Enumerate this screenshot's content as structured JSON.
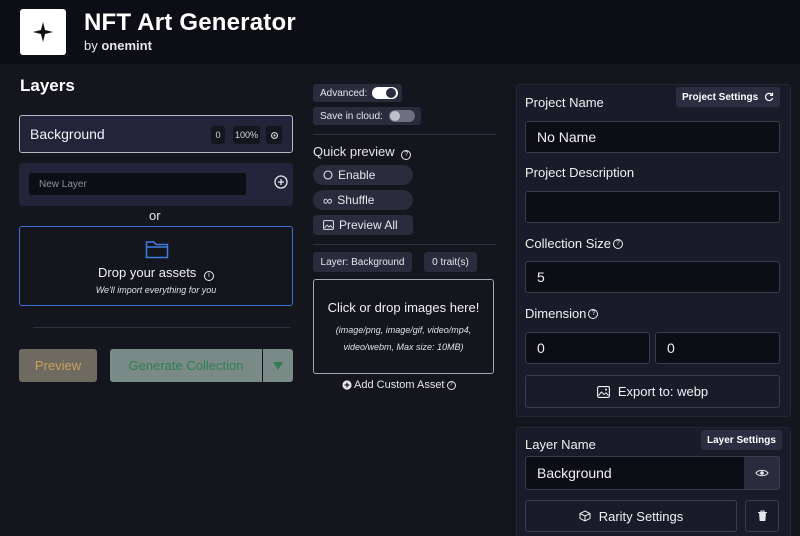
{
  "header": {
    "title": "NFT Art Generator",
    "by_prefix": "by",
    "by_brand": "onemint"
  },
  "layers": {
    "title": "Layers",
    "current": {
      "name": "Background",
      "count": "0",
      "percent": "100%"
    },
    "new_layer_placeholder": "New Layer",
    "or_text": "or",
    "drop_title": "Drop your assets",
    "drop_sub": "We'll import everything for you",
    "preview_label": "Preview",
    "generate_label": "Generate Collection"
  },
  "middle": {
    "advanced_label": "Advanced:",
    "save_cloud_label": "Save in cloud:",
    "quick_preview_title": "Quick preview",
    "enable_label": "Enable",
    "shuffle_label": "Shuffle",
    "preview_all_label": "Preview All",
    "layer_tag": "Layer: Background",
    "traits_tag": "0 trait(s)",
    "drop_images_title": "Click or drop images here!",
    "drop_images_sub": "(image/png, image/gif, video/mp4, video/webm, Max size: 10MB)",
    "add_custom_label": "Add Custom Asset"
  },
  "project": {
    "badge": "Project Settings",
    "name_label": "Project Name",
    "name_value": "No Name",
    "description_label": "Project Description",
    "description_value": "",
    "collection_size_label": "Collection Size",
    "collection_size_value": "5",
    "dimension_label": "Dimension",
    "width_value": "0",
    "height_value": "0",
    "export_label": "Export to: webp"
  },
  "layer_settings": {
    "badge": "Layer Settings",
    "name_label": "Layer Name",
    "name_value": "Background",
    "rarity_label": "Rarity Settings"
  },
  "colors": {
    "background": "#14151d",
    "header": "#0d0e15",
    "accent_blue": "#3e6fd8",
    "generate_text": "#2e7e55",
    "preview_text": "#c6a25c"
  }
}
